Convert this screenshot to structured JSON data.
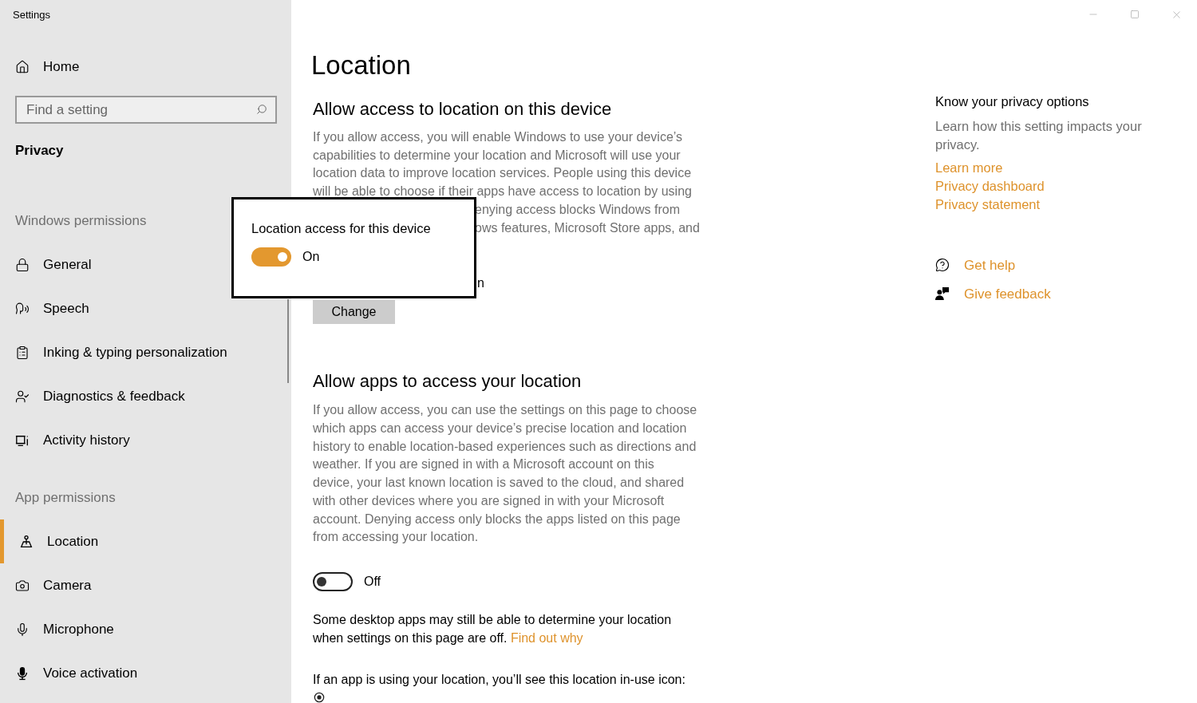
{
  "window": {
    "title": "Settings"
  },
  "sidebar": {
    "home": "Home",
    "search": {
      "placeholder": "Find a setting"
    },
    "section": "Privacy",
    "groups": [
      {
        "heading": "Windows permissions",
        "items": [
          {
            "label": "General",
            "selected": false
          },
          {
            "label": "Speech",
            "selected": false
          },
          {
            "label": "Inking & typing personalization",
            "selected": false
          },
          {
            "label": "Diagnostics & feedback",
            "selected": false
          },
          {
            "label": "Activity history",
            "selected": false
          }
        ]
      },
      {
        "heading": "App permissions",
        "items": [
          {
            "label": "Location",
            "selected": true
          },
          {
            "label": "Camera",
            "selected": false
          },
          {
            "label": "Microphone",
            "selected": false
          },
          {
            "label": "Voice activation",
            "selected": false
          }
        ]
      }
    ]
  },
  "page_title": "Location",
  "device_section": {
    "heading": "Allow access to location on this device",
    "description_lines": [
      "If you allow access, you will enable Windows to use your device’s",
      "capabilities to determine your location and Microsoft will use your",
      "location data to improve location services. People using this device",
      "will be able to choose if their apps have access to location by using"
    ],
    "covered_fragments": [
      "enying access blocks Windows from",
      "ows features, Microsoft Store apps, and"
    ],
    "status_fragment": "n",
    "button": "Change"
  },
  "popup": {
    "title": "Location access for this device",
    "toggle": {
      "on": true,
      "label": "On"
    }
  },
  "apps_section": {
    "heading": "Allow apps to access your location",
    "description_lines": [
      "If you allow access, you can use the settings on this page to choose",
      "which apps can access your device’s precise location and location",
      "history to enable location-based experiences such as directions and",
      "weather. If you are signed in with a Microsoft account on this",
      "device, your last known location is saved to the cloud, and shared",
      "with other devices where you are signed in with your Microsoft",
      "account. Denying access only blocks the apps listed on this page",
      "from accessing your location."
    ],
    "toggle": {
      "on": false,
      "label": "Off"
    },
    "note": {
      "lines": [
        "Some desktop apps may still be able to determine your location",
        "when settings on this page are off."
      ],
      "link": "Find out why"
    },
    "in_use_text": "If an app is using your location, you’ll see this location in-use icon:"
  },
  "aside": {
    "heading": "Know your privacy options",
    "text": "Learn how this setting impacts your privacy.",
    "links": [
      "Learn more",
      "Privacy dashboard",
      "Privacy statement"
    ],
    "actions": [
      "Get help",
      "Give feedback"
    ]
  }
}
